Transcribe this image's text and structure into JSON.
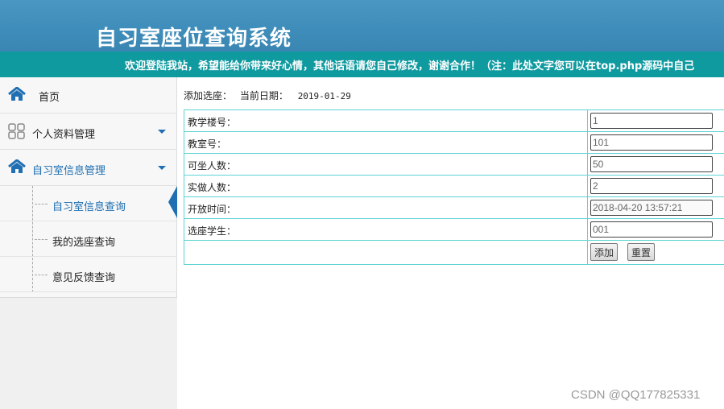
{
  "header": {
    "title": "自习室座位查询系统"
  },
  "marquee": {
    "text": "欢迎登陆我站，希望能给你带来好心情，其他话语请您自己修改，谢谢合作！（注：此处文字您可以在top.php源码中自己"
  },
  "sidebar": {
    "items": [
      {
        "label": "首页",
        "icon": "home-icon"
      },
      {
        "label": "个人资料管理",
        "icon": "grid-icon",
        "expandable": true
      },
      {
        "label": "自习室信息管理",
        "icon": "home-icon",
        "expandable": true,
        "expanded": true
      }
    ],
    "subitems": [
      {
        "label": "自习室信息查询",
        "active": true
      },
      {
        "label": "我的选座查询"
      },
      {
        "label": "意见反馈查询"
      }
    ],
    "accent_color": "#1f6fb2"
  },
  "breadcrumb": {
    "action": "添加选座：",
    "date_label": "当前日期：",
    "date": "2019-01-29"
  },
  "form": {
    "fields": [
      {
        "label": "教学楼号：",
        "value": "1"
      },
      {
        "label": "教室号：",
        "value": "101"
      },
      {
        "label": "可坐人数：",
        "value": "50"
      },
      {
        "label": "实做人数：",
        "value": "2"
      },
      {
        "label": "开放时间：",
        "value": "2018-04-20 13:57:21"
      },
      {
        "label": "选座学生：",
        "value": "001"
      }
    ],
    "submit_label": "添加",
    "reset_label": "重置",
    "border_color": "#5fd3d3"
  },
  "watermark": "CSDN @QQ177825331"
}
